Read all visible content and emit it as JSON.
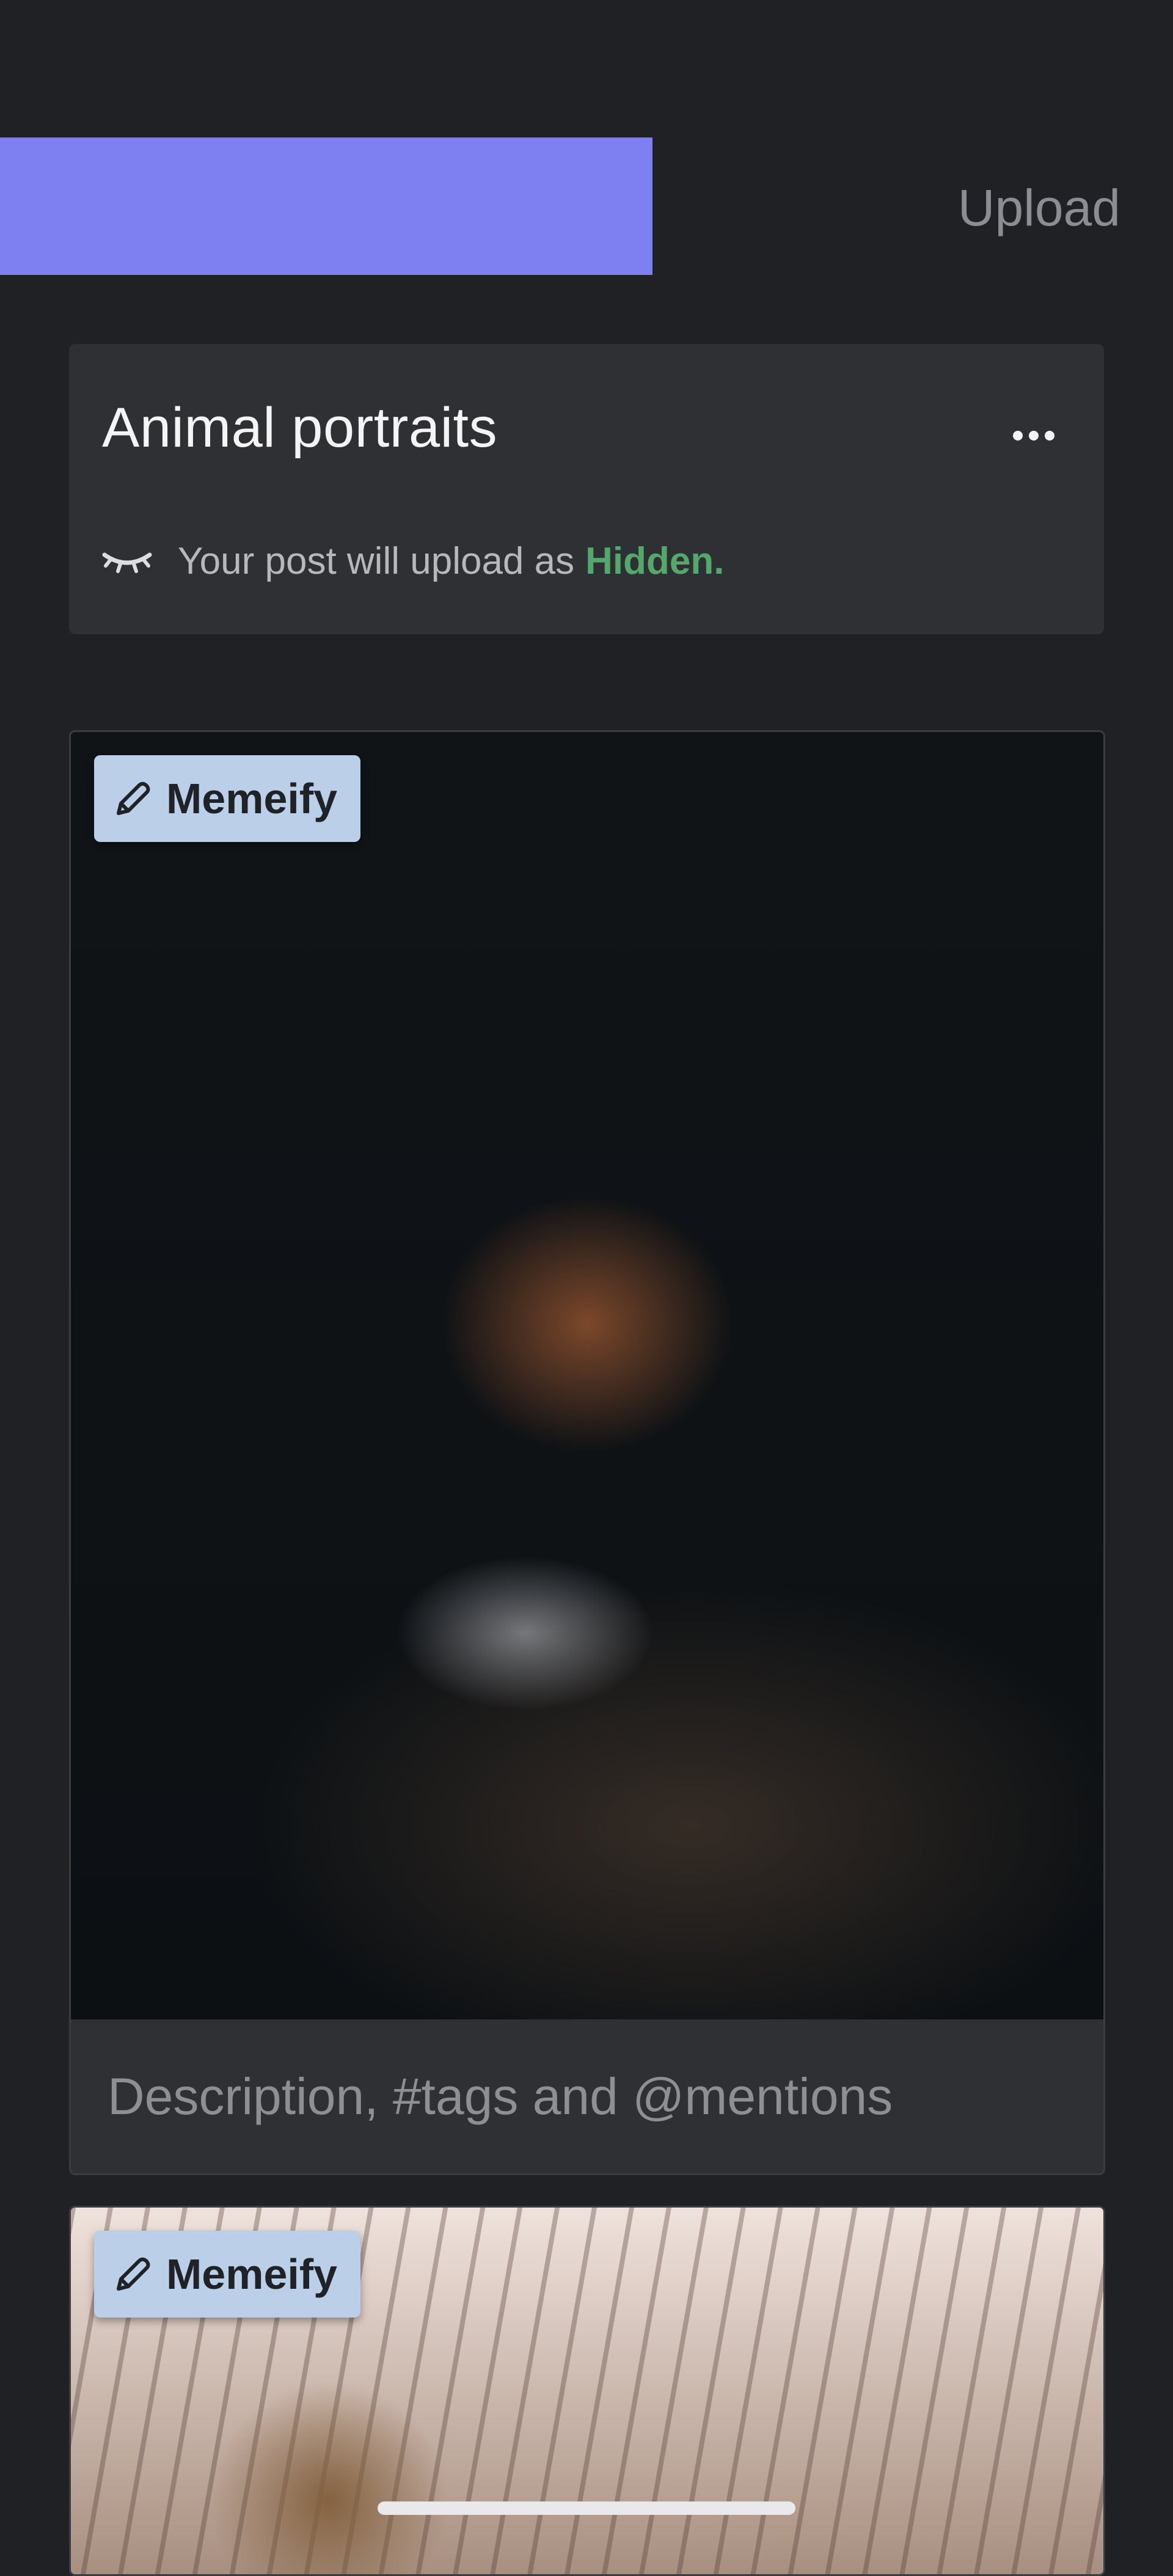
{
  "header": {
    "upload_label": "Upload",
    "progress": 0.556
  },
  "post": {
    "title": "Animal portraits",
    "visibility_prefix": "Your post will upload as",
    "visibility_value": "Hidden.",
    "more_icon": "more-horizontal-icon",
    "visibility_icon": "eye-closed-icon"
  },
  "images": [
    {
      "memeify_label": "Memeify",
      "description_placeholder": "Description, #tags and @mentions"
    },
    {
      "memeify_label": "Memeify"
    }
  ],
  "colors": {
    "accent": "#7e7ff0",
    "hidden": "#53a96c",
    "memeify_bg": "#bccfe8",
    "background": "#202124",
    "card": "#2f3034"
  }
}
